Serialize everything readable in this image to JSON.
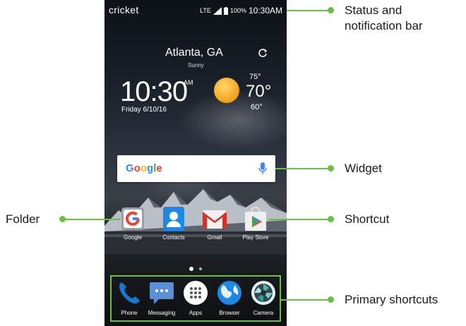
{
  "status_bar": {
    "carrier": "cricket",
    "network": "LTE",
    "battery": "100%",
    "time": "10:30AM"
  },
  "weather": {
    "city": "Atlanta, GA",
    "condition": "Sunny",
    "time": "10:30",
    "ampm": "AM",
    "date": "Friday  6/10/16",
    "high": "75°",
    "current": "70°",
    "low": "60°"
  },
  "search_widget": {
    "brand": "Google",
    "icon": "mic-icon"
  },
  "home_apps": [
    {
      "label": "Google",
      "icon": "google-folder-icon"
    },
    {
      "label": "Contacts",
      "icon": "contacts-icon"
    },
    {
      "label": "Gmail",
      "icon": "gmail-icon"
    },
    {
      "label": "Play Store",
      "icon": "play-store-icon"
    }
  ],
  "page_indicator": {
    "pages": 2,
    "current": 1
  },
  "dock": [
    {
      "label": "Phone",
      "icon": "phone-icon"
    },
    {
      "label": "Messaging",
      "icon": "messaging-icon"
    },
    {
      "label": "Apps",
      "icon": "apps-icon"
    },
    {
      "label": "Browser",
      "icon": "browser-icon"
    },
    {
      "label": "Camera",
      "icon": "camera-icon"
    }
  ],
  "callouts": {
    "status_bar": "Status and notification bar",
    "widget": "Widget",
    "folder": "Folder",
    "shortcut": "Shortcut",
    "primary": "Primary shortcuts"
  },
  "colors": {
    "accent": "#6ac045"
  }
}
